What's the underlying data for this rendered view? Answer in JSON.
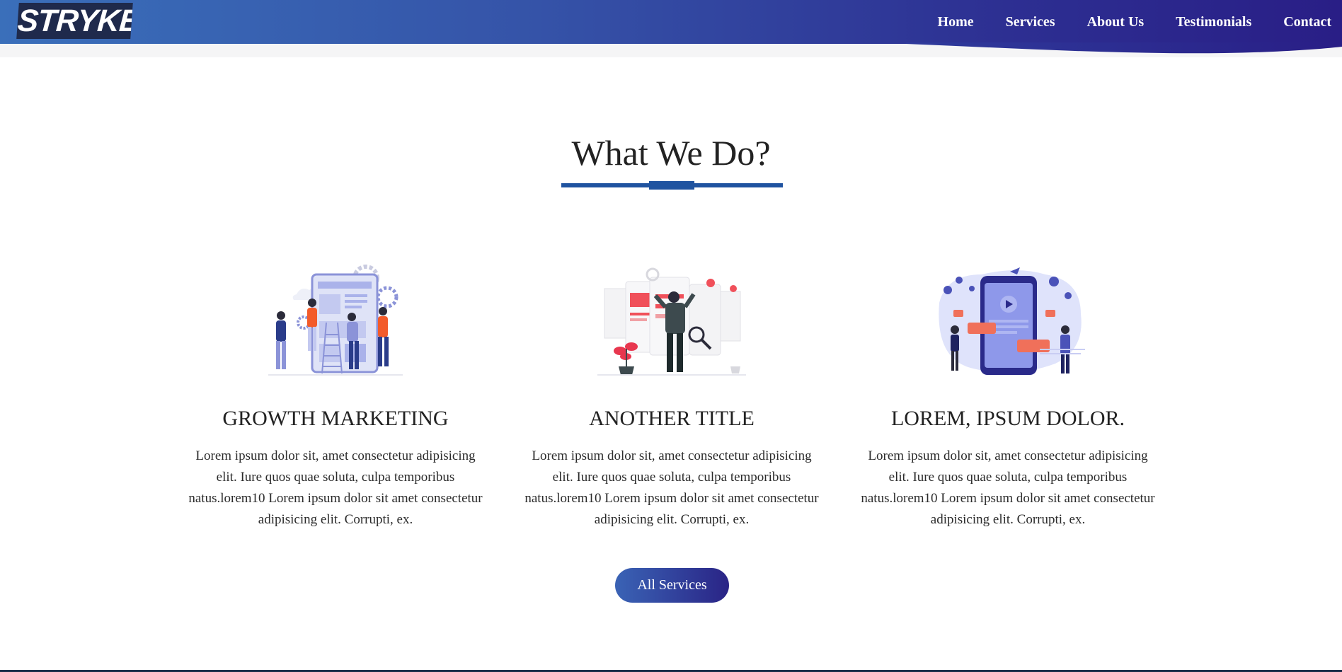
{
  "brand": {
    "logo_text": "STRYKER"
  },
  "nav": {
    "links": [
      "Home",
      "Services",
      "About Us",
      "Testimonials",
      "Contact"
    ]
  },
  "section": {
    "title": "What We Do?",
    "accent_color": "#1f53a0"
  },
  "services": [
    {
      "illustration": "team-building-app-illustration",
      "title": "GROWTH MARKETING",
      "text": "Lorem ipsum dolor sit, amet consectetur adipisicing elit. Iure quos quae soluta, culpa temporibus natus.lorem10 Lorem ipsum dolor sit amet consectetur adipisicing elit. Corrupti, ex."
    },
    {
      "illustration": "developer-reviewing-screens-illustration",
      "title": "ANOTHER TITLE",
      "text": "Lorem ipsum dolor sit, amet consectetur adipisicing elit. Iure quos quae soluta, culpa temporibus natus.lorem10 Lorem ipsum dolor sit amet consectetur adipisicing elit. Corrupti, ex."
    },
    {
      "illustration": "social-media-phone-illustration",
      "title": "LOREM, IPSUM DOLOR.",
      "text": "Lorem ipsum dolor sit, amet consectetur adipisicing elit. Iure quos quae soluta, culpa temporibus natus.lorem10 Lorem ipsum dolor sit amet consectetur adipisicing elit. Corrupti, ex."
    }
  ],
  "cta": {
    "label": "All Services"
  },
  "colors": {
    "nav_gradient_start": "#3a6fba",
    "nav_gradient_end": "#291e86",
    "button_gradient_start": "#3a63b5",
    "button_gradient_end": "#2a2486"
  }
}
